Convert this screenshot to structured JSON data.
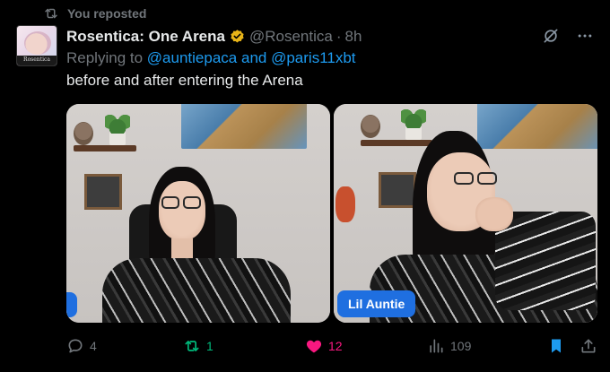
{
  "repost": {
    "label": "You reposted",
    "icon": "repost-icon"
  },
  "author": {
    "display_name": "Rosentica: One Arena",
    "verified": true,
    "handle": "@Rosentica",
    "separator": "·",
    "time": "8h",
    "avatar_caption": "Rosentica"
  },
  "reply": {
    "prefix": "Replying to",
    "mention_1": "@auntiepaca",
    "conjunction": "and",
    "mention_2": "@paris11xbt"
  },
  "text": "before and after entering the Arena",
  "media": {
    "right_name_tag": "Lil Auntie"
  },
  "actions": {
    "replies": "4",
    "reposts": "1",
    "likes": "12",
    "views": "109"
  },
  "colors": {
    "accent": "#1d9bf0",
    "repost_active": "#00ba7c",
    "like_active": "#f91880",
    "verified_gold": "#e8b418",
    "muted": "#71767b"
  }
}
